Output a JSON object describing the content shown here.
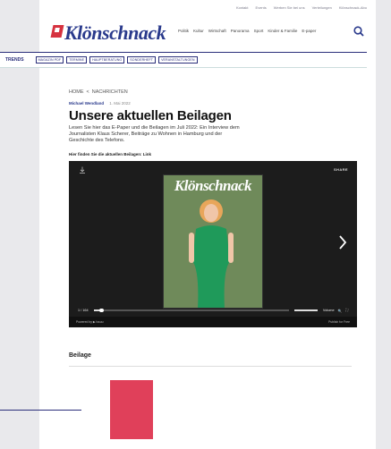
{
  "topbar": {
    "links": [
      "Kontakt",
      "Events",
      "Werben Sie bei uns",
      "Verteilungen",
      "Klönschnack-Abo"
    ]
  },
  "brand": {
    "logo_text": "Klönschnack"
  },
  "nav": {
    "items": [
      "Politik",
      "Kultur",
      "Wirtschaft",
      "Panorama",
      "Sport",
      "Kinder & Familie",
      "E-paper"
    ]
  },
  "trends": {
    "label": "TRENDS",
    "chips": [
      "MAGAZIN PDF",
      "TERMINE",
      "HAUPTBERATUNG",
      "SONDERHEFT",
      "VERANSTALTUNGEN"
    ]
  },
  "breadcrumb": {
    "home": "HOME",
    "sep": "<",
    "current": "NACHRICHTEN"
  },
  "article": {
    "author": "Michael Wendland",
    "date": "1. Mai 2022",
    "title": "Unsere aktuellen Beilagen",
    "intro": "Lesen Sie hier das E-Paper und die Beilagen im Juli 2022: Ein Interview dem Journalisten Klaus Scherer, Beiträge zu Wohnen in Hamburg und der Geschichte des Telefons.",
    "hint": "Hier finden Sie die aktuellen Beilagen: Link"
  },
  "player": {
    "share_label": "SHARE",
    "cover_title": "Klönschnack",
    "page_counter": "1 / 164",
    "volume_label": "Volume",
    "powered_by": "Powered by  ▶ Issuu",
    "publish_label": "Publish for Free",
    "progress": 0.04
  },
  "section": {
    "beilage_heading": "Beilage"
  },
  "colors": {
    "brand_blue": "#2a3a8c",
    "accent_red": "#e0405a",
    "nav_line": "#2a2e7a"
  }
}
